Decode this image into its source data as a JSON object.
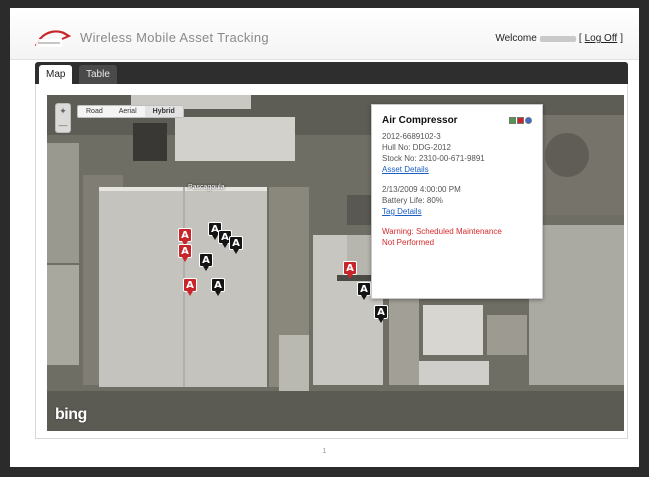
{
  "header": {
    "app_title": "Wireless Mobile Asset Tracking",
    "welcome_label": "Welcome",
    "bracket_open": "[",
    "logoff_label": "Log Off",
    "bracket_close": "]"
  },
  "tabs": [
    {
      "label": "Map",
      "active": true
    },
    {
      "label": "Table",
      "active": false
    }
  ],
  "map": {
    "types": [
      {
        "label": "Road",
        "active": false
      },
      {
        "label": "Aerial",
        "active": false
      },
      {
        "label": "Hybrid",
        "active": true
      }
    ],
    "place_label": "Pascagoula",
    "provider_logo": "bing",
    "markers": [
      {
        "letter": "A",
        "status": "alert"
      },
      {
        "letter": "A",
        "status": "alert"
      },
      {
        "letter": "A",
        "status": "alert"
      },
      {
        "letter": "A",
        "status": "alert"
      },
      {
        "letter": "A",
        "status": "normal"
      },
      {
        "letter": "A",
        "status": "normal"
      },
      {
        "letter": "A",
        "status": "normal"
      },
      {
        "letter": "A",
        "status": "normal"
      },
      {
        "letter": "A",
        "status": "normal"
      },
      {
        "letter": "A",
        "status": "normal"
      },
      {
        "letter": "A",
        "status": "normal"
      }
    ],
    "colors": {
      "alert": "#c8252a",
      "normal": "#141414"
    }
  },
  "popup": {
    "title": "Air Compressor",
    "asset_id": "2012-6689102-3",
    "hull_no": "Hull No: DDG-2012",
    "stock_no": "Stock No: 2310-00-671-9891",
    "asset_details_link": "Asset Details",
    "timestamp": "2/13/2009 4:00:00 PM",
    "battery_life": "Battery Life: 80%",
    "tag_details_link": "Tag Details",
    "warning_line1": "Warning: Scheduled Maintenance",
    "warning_line2": "Not Performed",
    "warning_color": "#d42b2b"
  },
  "footer": {
    "page_number": "1"
  }
}
